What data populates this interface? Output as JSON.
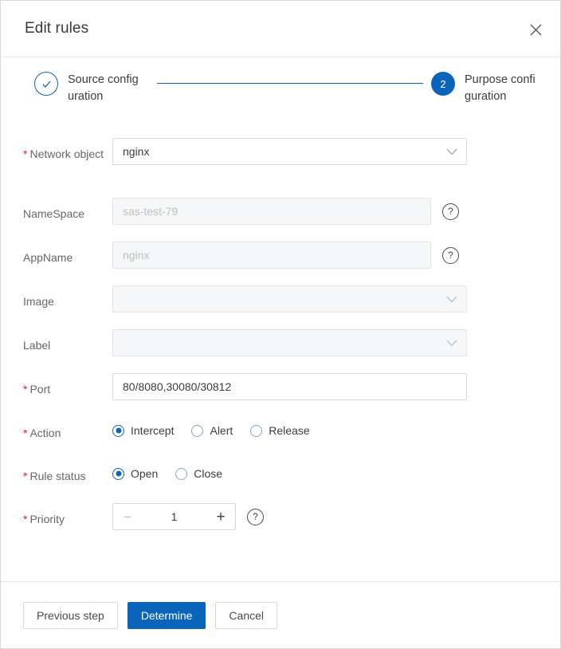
{
  "dialog": {
    "title": "Edit rules",
    "close_icon": "close-icon"
  },
  "stepper": {
    "steps": [
      {
        "id": "source",
        "marker": "✓",
        "label": "Source configuration",
        "state": "done"
      },
      {
        "id": "purpose",
        "marker": "2",
        "label": "Purpose configuration",
        "state": "active"
      }
    ]
  },
  "form": {
    "required_mark": "*",
    "fields": {
      "network_object": {
        "label": "Network object",
        "value": "nginx",
        "icon": "chevron-down-icon"
      },
      "namespace": {
        "label": "NameSpace",
        "placeholder": "sas-test-79",
        "value": "",
        "help": "?"
      },
      "appname": {
        "label": "AppName",
        "placeholder": "nginx",
        "value": "",
        "help": "?"
      },
      "image": {
        "label": "Image",
        "value": "",
        "icon": "chevron-down-icon"
      },
      "label_field": {
        "label": "Label",
        "value": "",
        "icon": "chevron-down-icon"
      },
      "port": {
        "label": "Port",
        "value": "80/8080,30080/30812"
      },
      "action": {
        "label": "Action",
        "options": [
          "Intercept",
          "Alert",
          "Release"
        ],
        "selected": "Intercept"
      },
      "rule_status": {
        "label": "Rule status",
        "options": [
          "Open",
          "Close"
        ],
        "selected": "Open"
      },
      "priority": {
        "label": "Priority",
        "value": "1",
        "decrement": "−",
        "increment": "+",
        "help": "?"
      }
    }
  },
  "footer": {
    "previous_label": "Previous step",
    "determine_label": "Determine",
    "cancel_label": "Cancel"
  },
  "colors": {
    "accent": "#0a65ba",
    "required": "#e02020",
    "border": "#d9d9d9",
    "disabled_bg": "#f6f7f8"
  }
}
